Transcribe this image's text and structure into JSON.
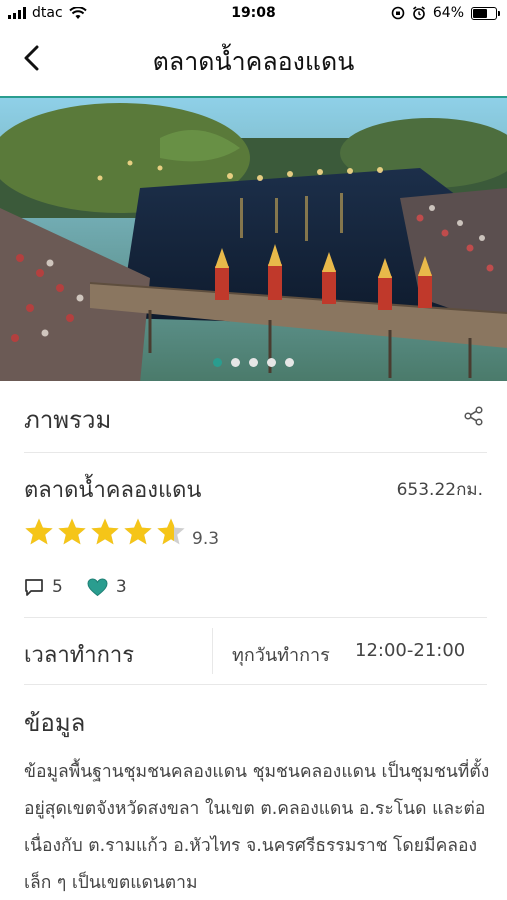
{
  "status_bar": {
    "carrier": "dtac",
    "time": "19:08",
    "battery_percent": "64%",
    "battery_level": 0.64
  },
  "header": {
    "title": "ตลาดน้ำคลองแดน",
    "back_icon": "chevron-left-icon"
  },
  "gallery": {
    "slide_count": 5,
    "active_index": 0
  },
  "overview": {
    "title": "ภาพรวม",
    "share_icon": "share-icon",
    "place_name": "ตลาดน้ำคลองแดน",
    "distance": "653.22กม.",
    "rating": "9.3",
    "star_rating": 4.6,
    "comments_count": "5",
    "likes_count": "3"
  },
  "hours": {
    "label": "เวลาทำการ",
    "days": "ทุกวันทำการ",
    "time": "12:00-21:00"
  },
  "info": {
    "title": "ข้อมูล",
    "text": "ข้อมูลพื้นฐานชุมชนคลองแดน ชุมชนคลองแดน เป็นชุมชนที่ตั้งอยู่สุดเขตจังหวัดสงขลา ในเขต ต.คลองแดน อ.ระโนด และต่อเนื่องกับ ต.รามแก้ว อ.หัวไทร จ.นครศรีธรรมราช โดยมีคลองเล็ก ๆ เป็นเขตแดนตาม"
  },
  "colors": {
    "accent": "#2a9d8f",
    "star": "#f5c518",
    "heart": "#2a9d8f"
  }
}
